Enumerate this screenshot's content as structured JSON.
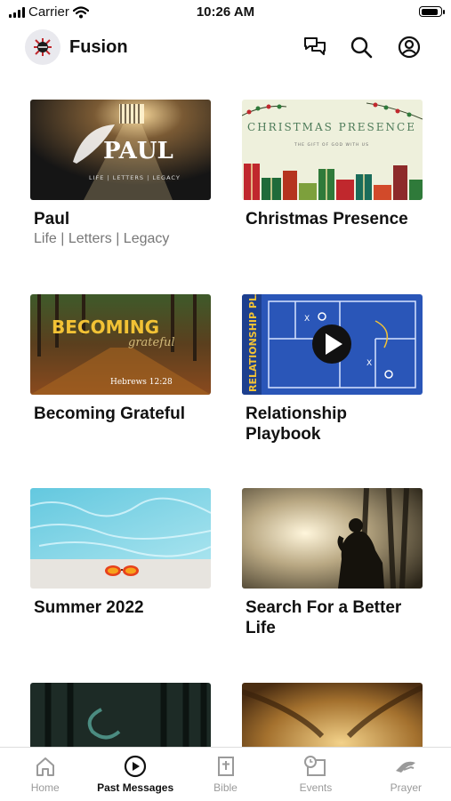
{
  "status_bar": {
    "carrier": "Carrier",
    "time": "10:26 AM",
    "battery_level": 0.9
  },
  "header": {
    "title": "Fusion",
    "icons": [
      "chat-bubbles-icon",
      "search-icon",
      "account-icon"
    ]
  },
  "messages": [
    {
      "title": "Paul",
      "subtitle": "Life | Letters | Legacy",
      "art_title": "PAUL",
      "art_sub": "LIFE | LETTERS | LEGACY"
    },
    {
      "title": "Christmas Presence",
      "art_title": "CHRISTMAS PRESENCE",
      "art_sub": "THE GIFT OF GOD WITH US"
    },
    {
      "title": "Becoming Grateful",
      "art_title": "BECOMING",
      "art_script": "grateful",
      "art_ref": "Hebrews 12:28"
    },
    {
      "title": "Relationship Playbook",
      "art_title": "RELATIONSHIP PLAYBOOK"
    },
    {
      "title": "Summer 2022"
    },
    {
      "title": "Search For a Better Life"
    },
    {
      "title": ""
    },
    {
      "title": ""
    }
  ],
  "tabs": [
    {
      "label": "Home",
      "icon": "home-icon",
      "active": false
    },
    {
      "label": "Past Messages",
      "icon": "play-circle-icon",
      "active": true
    },
    {
      "label": "Bible",
      "icon": "bible-icon",
      "active": false
    },
    {
      "label": "Events",
      "icon": "calendar-clock-icon",
      "active": false
    },
    {
      "label": "Prayer",
      "icon": "prayer-icon",
      "active": false
    }
  ],
  "colors": {
    "accent": "#111111",
    "inactive": "#9a9a9a"
  }
}
